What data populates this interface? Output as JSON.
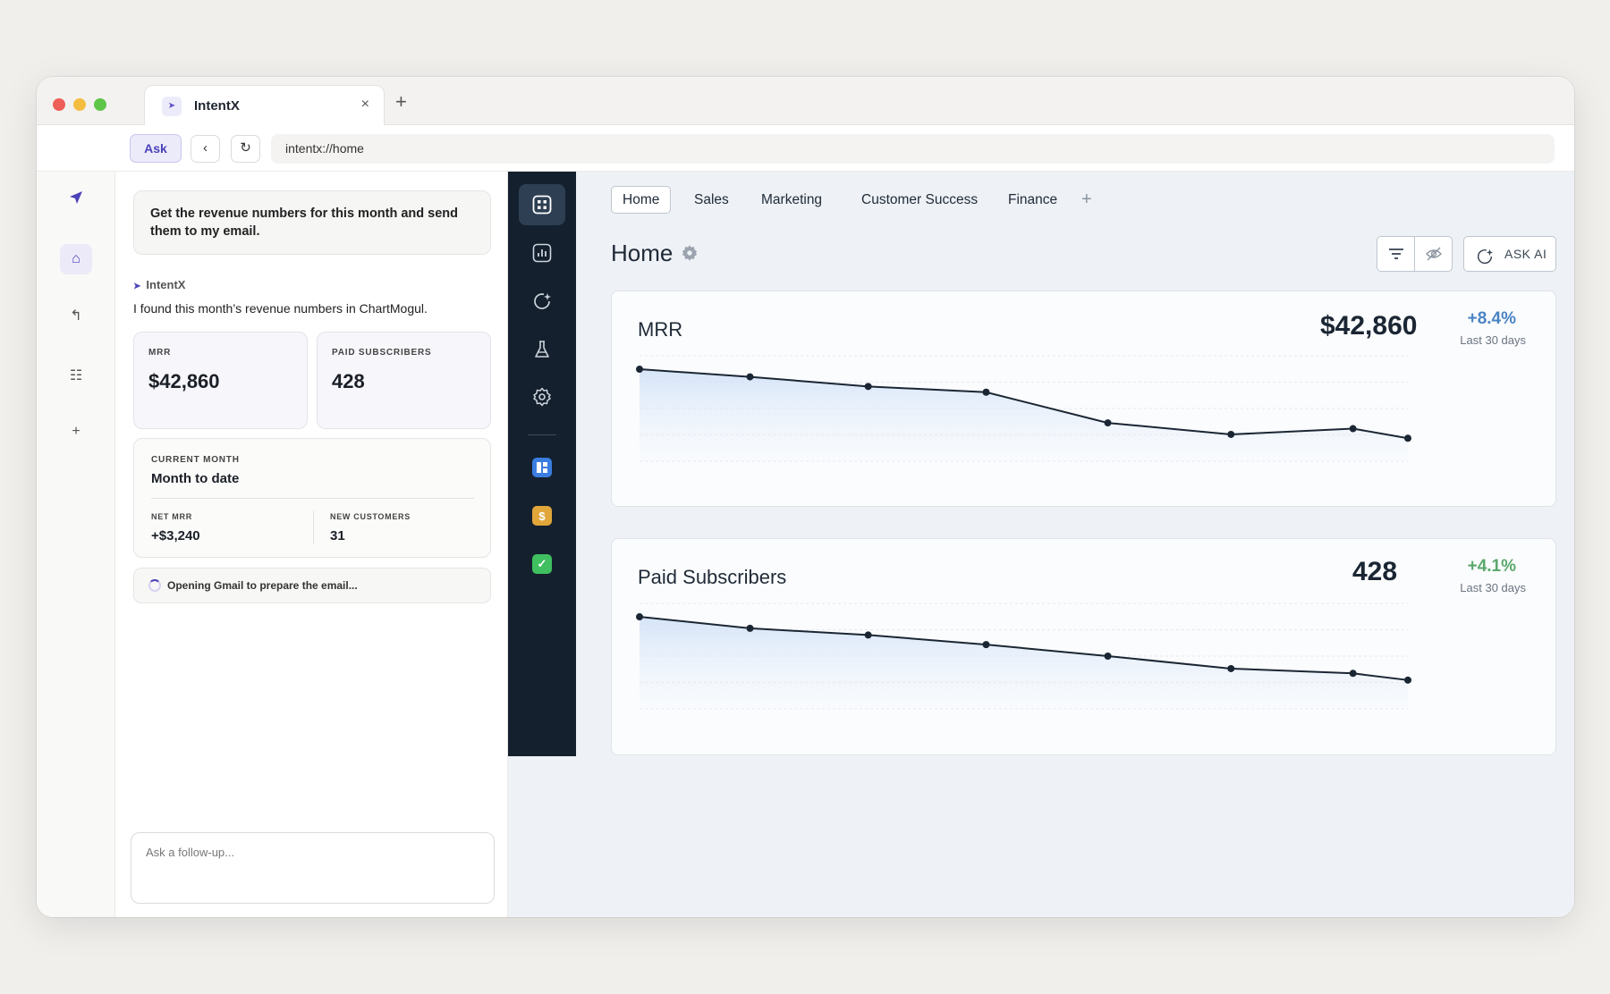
{
  "browser": {
    "tab_title": "IntentX",
    "tab_close": "×",
    "new_tab": "+",
    "ask_label": "Ask",
    "back": "‹",
    "reload": "↻",
    "url": "intentx://home"
  },
  "chat": {
    "user_message": "Get the revenue numbers for this month and send them to my email.",
    "agent_name": "IntentX",
    "agent_text": "I found this month’s revenue numbers in ChartMogul.",
    "stats": [
      {
        "label": "MRR",
        "value": "$42,860"
      },
      {
        "label": "PAID SUBSCRIBERS",
        "value": "428"
      }
    ],
    "month_card": {
      "label": "CURRENT MONTH",
      "title": "Month to date",
      "net_mrr_label": "NET MRR",
      "net_mrr_value": "+$3,240",
      "new_customers_label": "NEW CUSTOMERS",
      "new_customers_value": "31"
    },
    "status_text": "Opening Gmail to prepare the email...",
    "followup_placeholder": "Ask a follow-up..."
  },
  "dashboard": {
    "tabs": [
      "Home",
      "Sales",
      "Marketing",
      "Customer Success",
      "Finance"
    ],
    "add_tab": "+",
    "page_title": "Home",
    "ask_ai_label": "ASK AI",
    "accent_dark": "#14202e",
    "positive_blue": "#4a83c4",
    "positive_green": "#5aa86c"
  },
  "chart_data": [
    {
      "type": "area",
      "title": "MRR",
      "headline_value": "$42,860",
      "change": "+8.4%",
      "period": "Last 30 days",
      "values": [
        93,
        89,
        84,
        81,
        65,
        59,
        62,
        57
      ],
      "ylim": [
        45,
        100
      ],
      "grid": true
    },
    {
      "type": "area",
      "title": "Paid Subscribers",
      "headline_value": "428",
      "change": "+4.1%",
      "period": "Last 30 days",
      "values": [
        93,
        87,
        83.5,
        78.5,
        72.5,
        66,
        63.5,
        60
      ],
      "ylim": [
        45,
        100
      ],
      "grid": true
    }
  ]
}
